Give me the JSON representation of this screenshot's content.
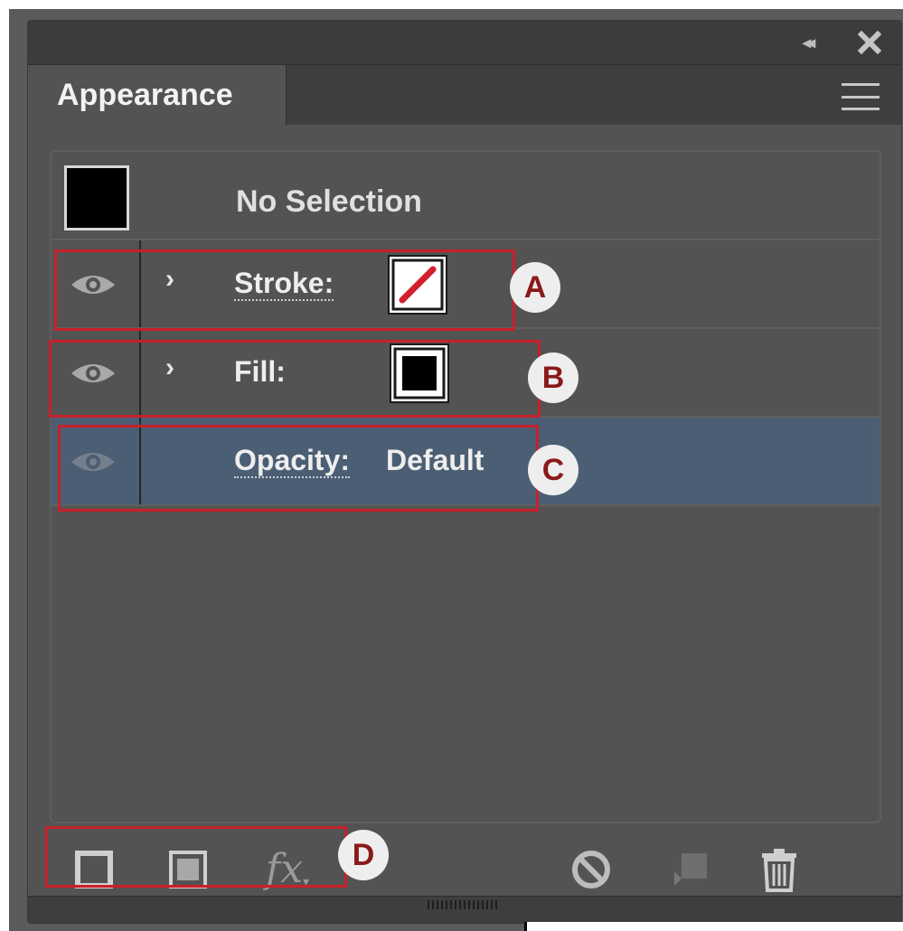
{
  "panel": {
    "tab_label": "Appearance",
    "no_selection": "No Selection",
    "rows": [
      {
        "label": "Stroke:",
        "swatch": "none-red-slash"
      },
      {
        "label": "Fill:",
        "swatch": "black"
      },
      {
        "label": "Opacity:",
        "value": "Default"
      }
    ]
  },
  "annotations": {
    "a": "A",
    "b": "B",
    "c": "C",
    "d": "D"
  },
  "icons": {
    "collapse": "double-chevron-left-icon",
    "close": "close-icon",
    "menu": "hamburger-menu-icon",
    "visibility": "eye-icon",
    "expand": "chevron-right-icon",
    "add_stroke": "add-new-stroke-icon",
    "add_fill": "add-new-fill-icon",
    "fx": "add-new-effect-icon",
    "clear": "clear-appearance-icon",
    "duplicate": "duplicate-item-icon",
    "delete": "trash-icon"
  },
  "colors": {
    "panel_bg": "#535353",
    "selected_row": "#4b5e74",
    "annotation": "#c8202a",
    "badge_text": "#8a1a1a"
  }
}
